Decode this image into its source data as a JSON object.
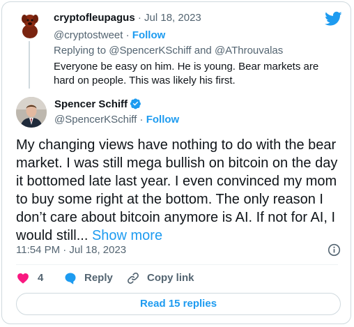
{
  "reply": {
    "name": "cryptofleupagus",
    "separator": "·",
    "date": "Jul 18, 2023",
    "handle": "@cryptostweet",
    "follow_label": "Follow",
    "replying_prefix": "Replying to",
    "replying_user1": "@SpencerKSchiff",
    "replying_and": "and",
    "replying_user2": "@AThrouvalas",
    "text": "Everyone be easy on him. He is young. Bear markets are hard on people. This was likely his first."
  },
  "tweet": {
    "name": "Spencer Schiff",
    "handle": "@SpencerKSchiff",
    "separator": "·",
    "follow_label": "Follow",
    "text": "My changing views have nothing to do with the bear market. I was still mega bullish on bitcoin on the day it bottomed  late last year. I even convinced my mom to buy some right at the bottom. The only reason I don’t care about bitcoin anymore is AI. If not for AI, I would still...",
    "show_more": "Show more",
    "timestamp": "11:54 PM · Jul 18, 2023"
  },
  "actions": {
    "like_count": "4",
    "reply_label": "Reply",
    "copy_label": "Copy link"
  },
  "read_replies_label": "Read 15 replies",
  "colors": {
    "accent": "#1d9bf0",
    "like": "#f91880",
    "muted": "#536471",
    "border": "#cfd9de"
  },
  "icons": [
    "twitter-bird-icon",
    "verified-badge-icon",
    "info-icon",
    "heart-icon",
    "reply-bubble-icon",
    "link-icon"
  ]
}
